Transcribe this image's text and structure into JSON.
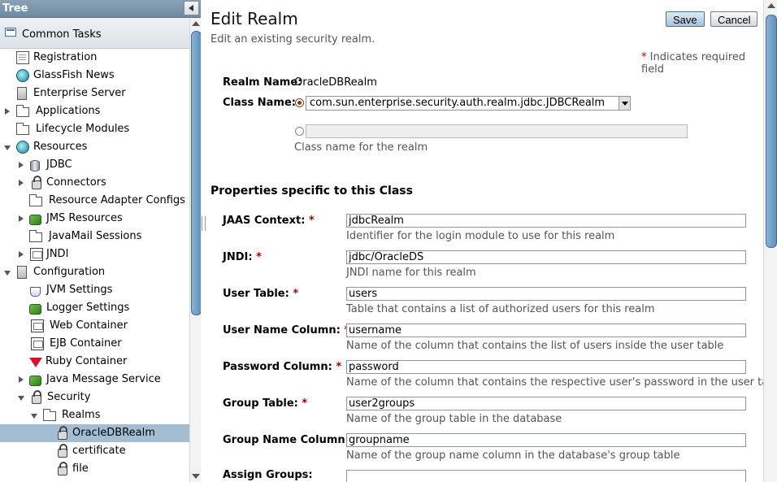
{
  "tree": {
    "title": "Tree",
    "common_tasks": "Common Tasks",
    "items": [
      {
        "label": "Registration"
      },
      {
        "label": "GlassFish News"
      },
      {
        "label": "Enterprise Server"
      },
      {
        "label": "Applications"
      },
      {
        "label": "Lifecycle Modules"
      },
      {
        "label": "Resources"
      },
      {
        "label": "JDBC"
      },
      {
        "label": "Connectors"
      },
      {
        "label": "Resource Adapter Configs"
      },
      {
        "label": "JMS Resources"
      },
      {
        "label": "JavaMail Sessions"
      },
      {
        "label": "JNDI"
      },
      {
        "label": "Configuration"
      },
      {
        "label": "JVM Settings"
      },
      {
        "label": "Logger Settings"
      },
      {
        "label": "Web Container"
      },
      {
        "label": "EJB Container"
      },
      {
        "label": "Ruby Container"
      },
      {
        "label": "Java Message Service"
      },
      {
        "label": "Security"
      },
      {
        "label": "Realms"
      },
      {
        "label": "OracleDBRealm"
      },
      {
        "label": "certificate"
      },
      {
        "label": "file"
      }
    ]
  },
  "page": {
    "title": "Edit Realm",
    "help": "Edit an existing security realm.",
    "save_label": "Save",
    "cancel_label": "Cancel",
    "required_marker": "*",
    "required_note": "Indicates required field"
  },
  "realm": {
    "name_label": "Realm Name:",
    "name_value": "OracleDBRealm",
    "class_label": "Class Name:",
    "class_value": "com.sun.enterprise.security.auth.realm.jdbc.JDBCRealm",
    "class_help": "Class name for the realm"
  },
  "properties": {
    "heading": "Properties specific to this Class",
    "fields": [
      {
        "label": "JAAS Context:",
        "value": "jdbcRealm",
        "help": "Identifier for the login module to use for this realm"
      },
      {
        "label": "JNDI:",
        "value": "jdbc/OracleDS",
        "help": "JNDI name for this realm"
      },
      {
        "label": "User Table:",
        "value": "users",
        "help": "Table that contains a list of authorized users for this realm"
      },
      {
        "label": "User Name Column:",
        "value": "username",
        "help": "Name of the column that contains the list of users inside the user table"
      },
      {
        "label": "Password Column:",
        "value": "password",
        "help": "Name of the column that contains the respective user's password in the user table"
      },
      {
        "label": "Group Table:",
        "value": "user2groups",
        "help": "Name of the group table in the database"
      },
      {
        "label": "Group Name Column:",
        "value": "groupname",
        "help": "Name of the group name column in the database's group table"
      },
      {
        "label": "Assign Groups:",
        "value": ""
      }
    ]
  }
}
